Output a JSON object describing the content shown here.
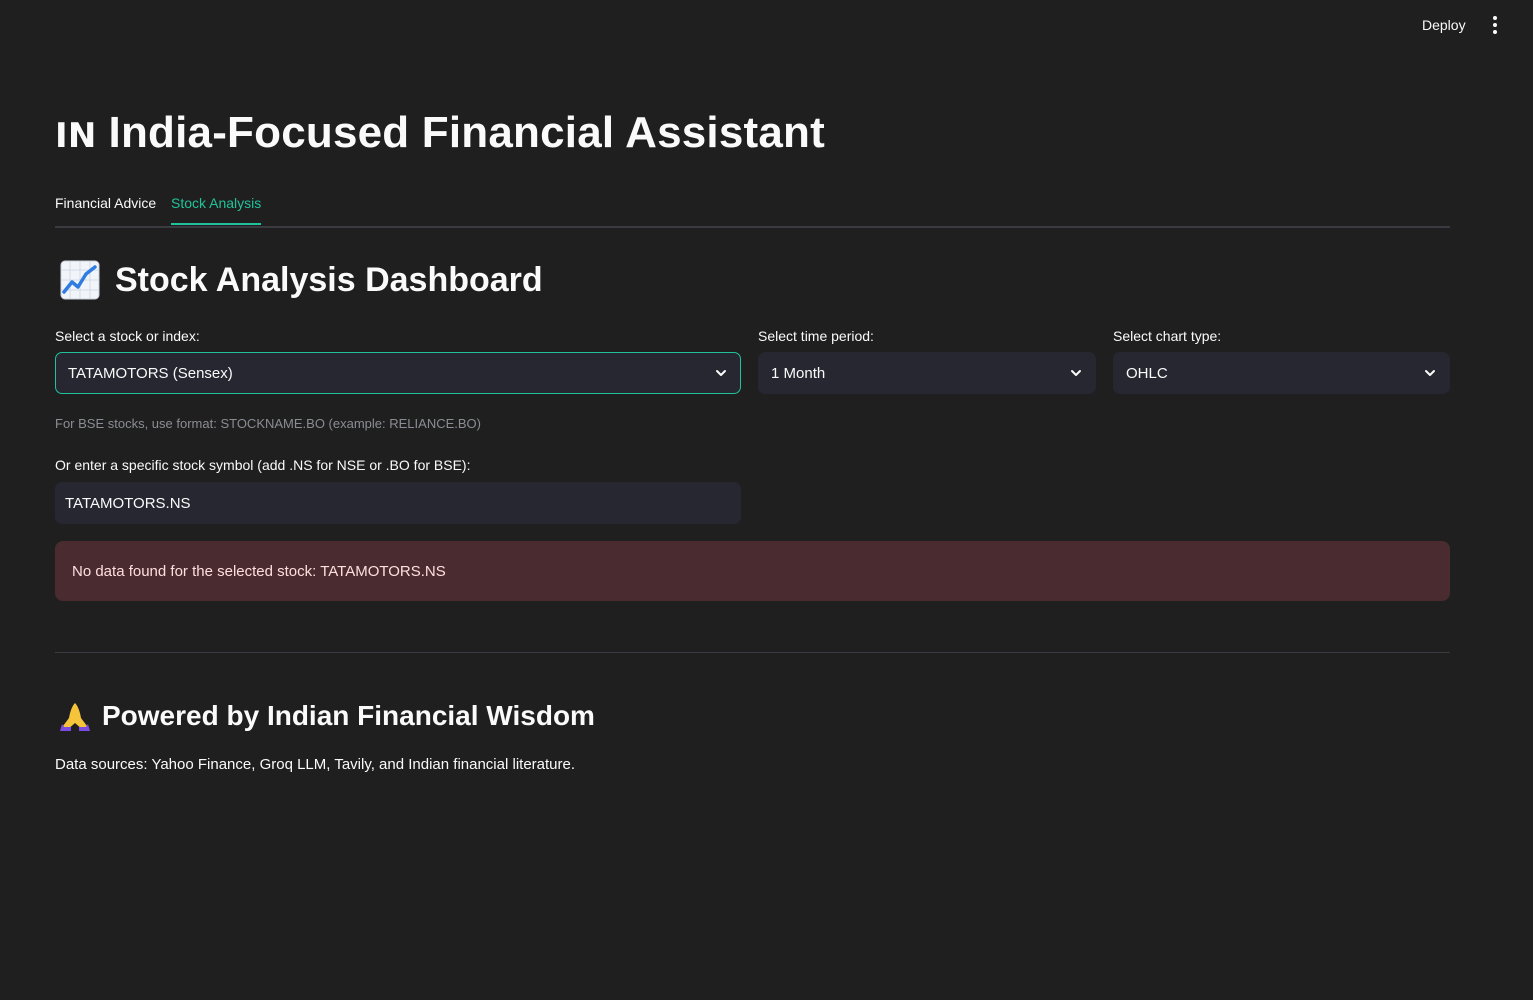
{
  "header": {
    "deploy_label": "Deploy",
    "menu_icon": "kebab-menu-icon"
  },
  "app": {
    "flag_text": "IN",
    "title": "India-Focused Financial Assistant"
  },
  "tabs": [
    {
      "label": "Financial Advice",
      "active": false
    },
    {
      "label": "Stock Analysis",
      "active": true
    }
  ],
  "accent_color": "#21c29a",
  "dashboard": {
    "icon": "chart-increasing-icon",
    "title": "Stock Analysis Dashboard"
  },
  "stock_select": {
    "label": "Select a stock or index:",
    "value": "TATAMOTORS (Sensex)"
  },
  "period_select": {
    "label": "Select time period:",
    "value": "1 Month"
  },
  "chart_type_select": {
    "label": "Select chart type:",
    "value": "OHLC"
  },
  "help_text": "For BSE stocks, use format: STOCKNAME.BO (example: RELIANCE.BO)",
  "symbol_input": {
    "label": "Or enter a specific stock symbol (add .NS for NSE or .BO for BSE):",
    "value": "TATAMOTORS.NS"
  },
  "error_message": "No data found for the selected stock: TATAMOTORS.NS",
  "footer": {
    "icon": "folded-hands-icon",
    "title": "Powered by Indian Financial Wisdom",
    "text": "Data sources: Yahoo Finance, Groq LLM, Tavily, and Indian financial literature."
  }
}
